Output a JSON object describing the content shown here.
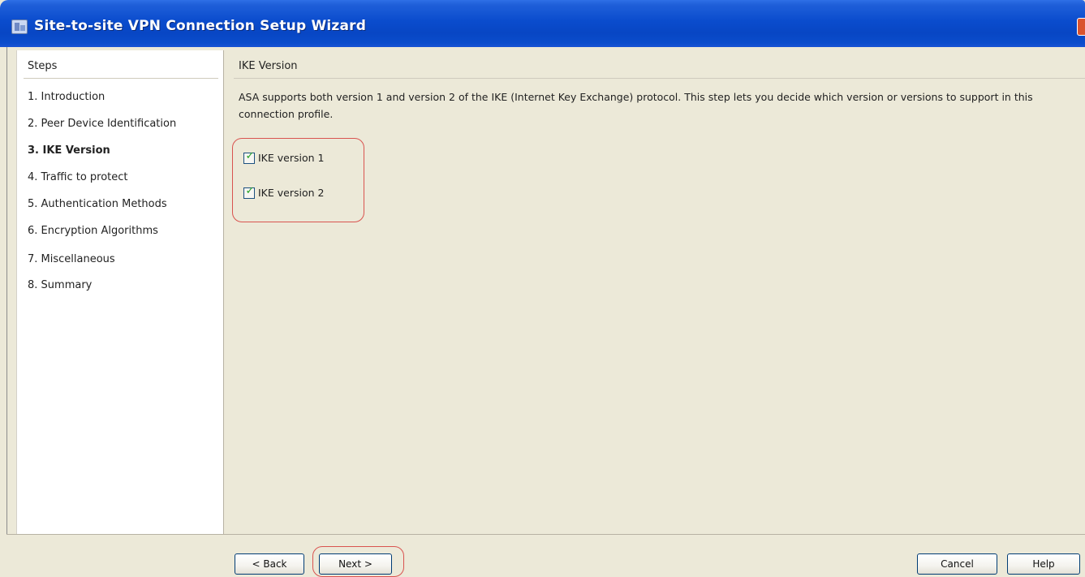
{
  "window": {
    "title": "Site-to-site VPN Connection Setup Wizard"
  },
  "steps_panel": {
    "header": "Steps",
    "items": [
      {
        "label": "1.  Introduction",
        "active": false
      },
      {
        "label": "2.  Peer Device Identification",
        "active": false
      },
      {
        "label": "3.  IKE Version",
        "active": true
      },
      {
        "label": "4.  Traffic to protect",
        "active": false
      },
      {
        "label": "5.  Authentication Methods",
        "active": false
      },
      {
        "label": "6.  Encryption Algorithms",
        "active": false
      },
      {
        "label": "7.  Miscellaneous",
        "active": false
      },
      {
        "label": "8.  Summary",
        "active": false
      }
    ]
  },
  "main": {
    "header": "IKE Version",
    "description": "ASA supports both version 1 and version 2 of the IKE (Internet Key Exchange) protocol. This step lets you decide which version or versions to support in this connection profile.",
    "checkboxes": [
      {
        "label": "IKE version 1",
        "checked": true
      },
      {
        "label": "IKE version 2",
        "checked": true
      }
    ]
  },
  "footer": {
    "back_label": "< Back",
    "next_label": "Next >",
    "cancel_label": "Cancel",
    "help_label": "Help"
  },
  "colors": {
    "titlebar": "#0a4ccd",
    "highlight": "#d9534f",
    "checkmark": "#21a121"
  }
}
